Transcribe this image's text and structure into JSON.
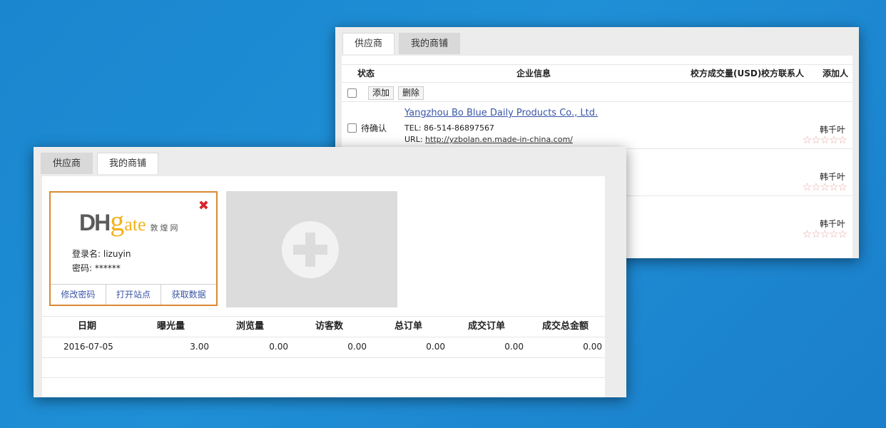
{
  "back_window": {
    "tabs": [
      {
        "label": "供应商",
        "active": true
      },
      {
        "label": "我的商铺",
        "active": false
      }
    ],
    "columns": {
      "status": "状态",
      "company_info": "企业信息",
      "volume": "校方成交量(USD)",
      "contact": "校方联系人",
      "adder": "添加人"
    },
    "actions": {
      "add": "添加",
      "delete": "删除"
    },
    "rows": [
      {
        "status": "待确认",
        "company": "Yangzhou Bo Blue Daily Products Co., Ltd.",
        "tel_label": "TEL:",
        "tel": "86-514-86897567",
        "url_label": "URL:",
        "url": "http://yzbolan.en.made-in-china.com/",
        "adder": "韩千叶",
        "stars": "☆☆☆☆☆"
      },
      {
        "adder": "韩千叶",
        "stars": "☆☆☆☆☆"
      },
      {
        "adder": "韩千叶",
        "stars": "☆☆☆☆☆"
      }
    ]
  },
  "front_window": {
    "tabs": [
      {
        "label": "供应商",
        "active": false
      },
      {
        "label": "我的商铺",
        "active": true
      }
    ],
    "card": {
      "logo_dh": "DH",
      "logo_g": "g",
      "logo_ate": "ate",
      "logo_cn": "敦煌网",
      "close": "✖",
      "login_label": "登录名:",
      "login_value": "lizuyin",
      "password_label": "密码:",
      "password_value": "******",
      "buttons": [
        "修改密码",
        "打开站点",
        "获取数据"
      ]
    },
    "stats": {
      "headers": [
        "日期",
        "曝光量",
        "浏览量",
        "访客数",
        "总订单",
        "成交订单",
        "成交总金额"
      ],
      "rows": [
        [
          "2016-07-05",
          "3.00",
          "0.00",
          "0.00",
          "0.00",
          "0.00",
          "0.00"
        ]
      ]
    }
  }
}
